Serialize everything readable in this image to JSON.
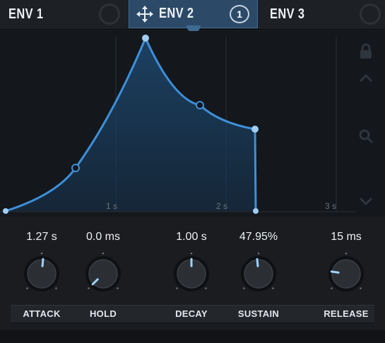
{
  "tabs": [
    {
      "label": "ENV 1",
      "active": false
    },
    {
      "label": "ENV 2",
      "active": true,
      "modulation_count": "1"
    },
    {
      "label": "ENV 3",
      "active": false
    }
  ],
  "graph": {
    "time_labels": [
      "1 s",
      "2 s",
      "3 s"
    ]
  },
  "knobs": [
    {
      "name": "ATTACK",
      "value": "1.27 s",
      "level": 0.52
    },
    {
      "name": "HOLD",
      "value": "0.0 ms",
      "level": 0.0
    },
    {
      "name": "DECAY",
      "value": "1.00 s",
      "level": 0.5
    },
    {
      "name": "SUSTAIN",
      "value": "47.95%",
      "level": 0.48
    },
    {
      "name": "RELEASE",
      "value": "15 ms",
      "level": 0.2
    }
  ],
  "colors": {
    "accent": "#3d8fd8",
    "active_tab": "#2c4a68",
    "background": "#14171b"
  },
  "icons": [
    "move-icon",
    "lock-icon",
    "chevron-up-icon",
    "zoom-icon",
    "chevron-down-icon"
  ]
}
